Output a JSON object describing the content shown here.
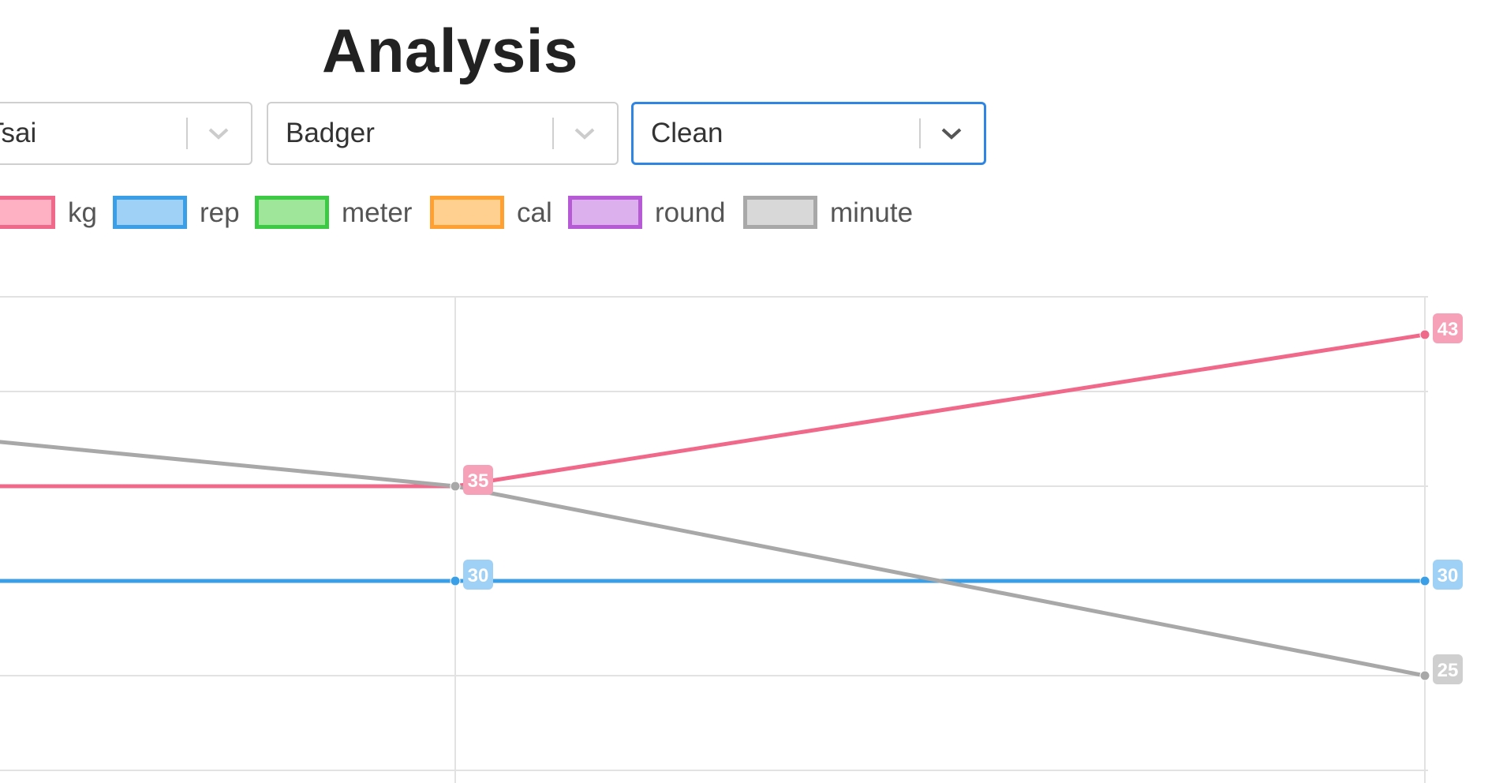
{
  "page": {
    "title": "Analysis"
  },
  "filters": [
    {
      "value": "Tsai",
      "focused": false
    },
    {
      "value": "Badger",
      "focused": false
    },
    {
      "value": "Clean",
      "focused": true
    }
  ],
  "icons": {
    "dropdown": "chevron-down-icon"
  },
  "colors": {
    "focus": "#2f86e2",
    "kg": "#f0688a",
    "rep": "#3a9fe6",
    "meter": "#3cc944",
    "cal": "#ffa033",
    "round": "#b75ad6",
    "minute": "#a8a8a8"
  },
  "legend": [
    {
      "label": "kg",
      "border": "#f0688a",
      "fill": "#fdb1c3"
    },
    {
      "label": "rep",
      "border": "#3a9fe6",
      "fill": "#9fd0f5"
    },
    {
      "label": "meter",
      "border": "#3cc944",
      "fill": "#9fe69b"
    },
    {
      "label": "cal",
      "border": "#ffa033",
      "fill": "#ffd08f"
    },
    {
      "label": "round",
      "border": "#b75ad6",
      "fill": "#dcb0ec"
    },
    {
      "label": "minute",
      "border": "#a8a8a8",
      "fill": "#d8d8d8"
    }
  ],
  "chart_data": {
    "type": "line",
    "x": [
      "",
      "",
      ""
    ],
    "ylim": [
      20,
      45
    ],
    "grid": true,
    "legend_position": "top",
    "series": [
      {
        "name": "kg",
        "color": "#f0688a",
        "values": [
          35,
          35,
          43
        ],
        "labels": [
          "",
          "35",
          "43"
        ],
        "label_color": "#f7a1b8"
      },
      {
        "name": "rep",
        "color": "#3a9fe6",
        "values": [
          30,
          30,
          30
        ],
        "labels": [
          "",
          "30",
          "30"
        ],
        "label_color": "#9fd0f5"
      },
      {
        "name": "minute",
        "color": "#a8a8a8",
        "values": [
          37.5,
          35,
          25
        ],
        "labels": [
          "",
          "",
          "25"
        ],
        "label_color": "#cfcfcf"
      }
    ]
  }
}
